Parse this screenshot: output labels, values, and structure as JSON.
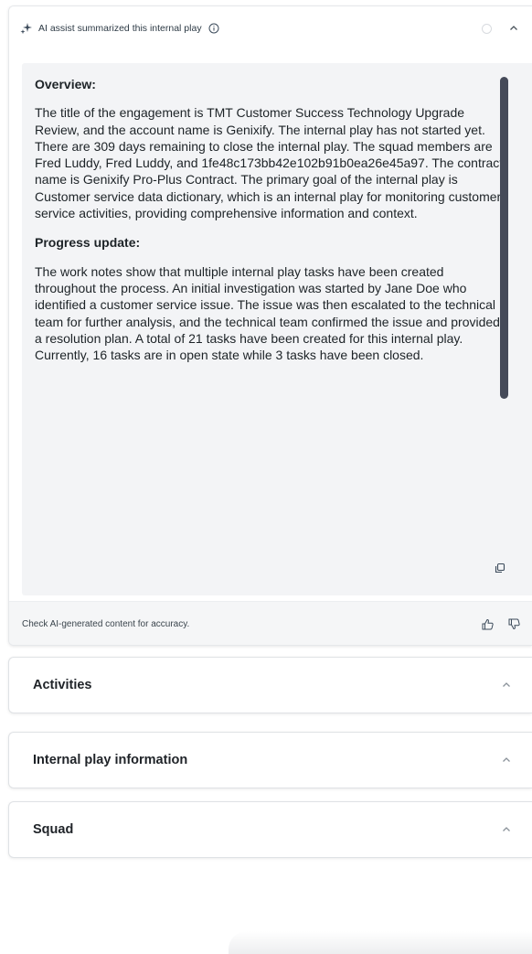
{
  "ai_summary": {
    "header_title": "AI assist summarized this internal play",
    "icons": {
      "sparkle": "sparkle-icon",
      "info": "info-icon",
      "loading": "spinner-icon",
      "collapse": "chevron-up-icon",
      "copy": "copy-icon",
      "thumbs_up": "thumbs-up-icon",
      "thumbs_down": "thumbs-down-icon"
    },
    "sections": [
      {
        "heading": "Overview:",
        "text": "The title of the engagement is TMT Customer Success Technology Upgrade Review, and the account name is Genixify. The internal play has not started yet. There are 309 days remaining to close the internal play. The squad members are Fred Luddy, Fred Luddy, and 1fe48c173bb42e102b91b0ea26e45a97. The contract name is Genixify Pro-Plus Contract. The primary goal of the internal play is Customer service data dictionary, which is an internal play for monitoring customer service activities, providing comprehensive information and context."
      },
      {
        "heading": "Progress update:",
        "text": "The work notes show that multiple internal play tasks have been created throughout the process. An initial investigation was started by Jane Doe who identified a customer service issue. The issue was then escalated to the technical team for further analysis, and the technical team confirmed the issue and provided a resolution plan. A total of 21 tasks have been created for this internal play. Currently, 16 tasks are in open state while 3 tasks have been closed."
      }
    ],
    "disclaimer": "Check AI-generated content for accuracy."
  },
  "accordions": [
    {
      "title": "Activities",
      "icon": "chevron-up-icon"
    },
    {
      "title": "Internal play information",
      "icon": "chevron-up-icon"
    },
    {
      "title": "Squad",
      "icon": "chevron-up-icon"
    }
  ],
  "colors": {
    "scrollbar_thumb": "#454a59",
    "summary_background": "#f3f4f6",
    "icon_gray": "#8a929a",
    "text": "#1f2328"
  }
}
